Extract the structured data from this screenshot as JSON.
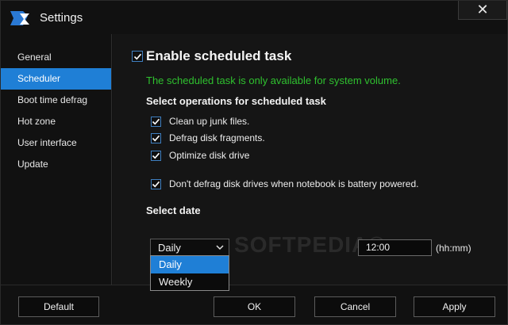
{
  "window": {
    "title": "Settings",
    "close_label": "✕"
  },
  "sidebar": {
    "items": [
      {
        "label": "General",
        "active": false
      },
      {
        "label": "Scheduler",
        "active": true
      },
      {
        "label": "Boot time defrag",
        "active": false
      },
      {
        "label": "Hot zone",
        "active": false
      },
      {
        "label": "User interface",
        "active": false
      },
      {
        "label": "Update",
        "active": false
      }
    ]
  },
  "scheduler": {
    "enable_label": "Enable scheduled task",
    "enable_checked": true,
    "info": "The scheduled task is only available for system volume.",
    "operations_title": "Select operations for scheduled task",
    "options": [
      {
        "label": "Clean up junk files.",
        "checked": true
      },
      {
        "label": "Defrag disk fragments.",
        "checked": true
      },
      {
        "label": "Optimize disk drive",
        "checked": true
      },
      {
        "label": "Don't defrag disk drives when notebook is battery powered.",
        "checked": true
      }
    ],
    "date_title": "Select date",
    "frequency": {
      "selected": "Daily",
      "options": [
        "Daily",
        "Weekly"
      ]
    },
    "time_value": "12:00",
    "time_hint": "(hh:mm)"
  },
  "watermark": "SOFTPEDIA®",
  "footer": {
    "default_label": "Default",
    "ok_label": "OK",
    "cancel_label": "Cancel",
    "apply_label": "Apply"
  },
  "colors": {
    "accent": "#1f7fd6",
    "info_green": "#2fc12f",
    "background": "#121212"
  }
}
